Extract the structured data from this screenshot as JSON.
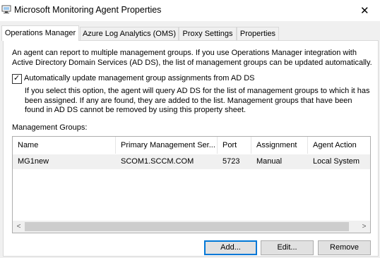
{
  "window": {
    "title": "Microsoft Monitoring Agent Properties",
    "close_glyph": "✕"
  },
  "tabs": [
    {
      "label": "Operations Manager",
      "active": true
    },
    {
      "label": "Azure Log Analytics (OMS)",
      "active": false
    },
    {
      "label": "Proxy Settings",
      "active": false
    },
    {
      "label": "Properties",
      "active": false
    }
  ],
  "panel": {
    "intro": "An agent can report to multiple management groups. If you use Operations Manager integration with\nActive Directory Domain Services (AD DS), the list of management groups can be updated automatically.",
    "auto_update": {
      "checked": true,
      "check_glyph": "✓",
      "label": "Automatically update management group assignments from AD DS",
      "description": "If you select this option, the agent will query AD DS for the list of management groups to which it has\nbeen assigned. If any are found, they are added to the list. Management groups that have been\nfound in AD DS cannot be removed by using this property sheet."
    },
    "groups_label": "Management Groups:",
    "table": {
      "columns": [
        "Name",
        "Primary Management Ser...",
        "Port",
        "Assignment",
        "Agent Action"
      ],
      "rows": [
        [
          "MG1new",
          "SCOM1.SCCM.COM",
          "5723",
          "Manual",
          "Local System"
        ]
      ]
    },
    "scroll": {
      "left_glyph": "<",
      "right_glyph": ">"
    },
    "buttons": {
      "add": "Add...",
      "edit": "Edit...",
      "remove": "Remove"
    }
  },
  "colors": {
    "accent": "#0078d7",
    "selection": "#f0f0f0"
  },
  "icons": {
    "app": "monitoring-agent-icon",
    "close": "close-icon"
  }
}
